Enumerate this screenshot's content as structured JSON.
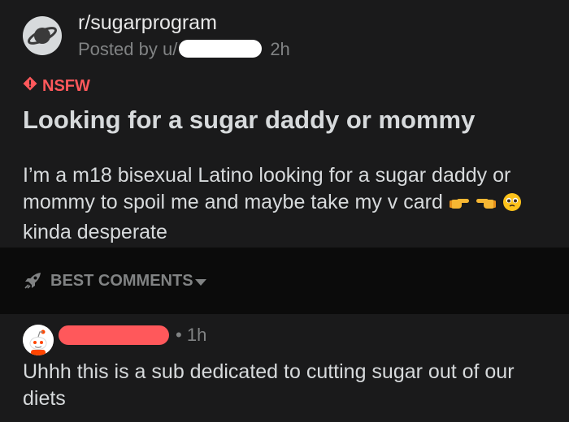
{
  "post": {
    "subreddit": "r/sugarprogram",
    "posted_by_prefix": "Posted by u/",
    "time": "2h",
    "nsfw_label": "NSFW",
    "title": "Looking for a sugar daddy or mommy",
    "body": "I’m a m18 bisexual Latino looking for a sugar daddy or mommy to spoil me and maybe take my v card",
    "body_tail": "kinda desperate",
    "emojis": [
      "backhand-index-pointing-right-icon",
      "backhand-index-pointing-left-icon",
      "pleading-face-icon"
    ]
  },
  "sort": {
    "label": "BEST COMMENTS",
    "icon": "rocket-icon"
  },
  "comment": {
    "time": "1h",
    "text": "Uhhh this is a sub dedicated to cutting sugar out of our diets"
  },
  "colors": {
    "background": "#1a1a1b",
    "sort_bar": "#0b0b0b",
    "text": "#d7dadc",
    "muted": "#818384",
    "nsfw": "#ff585b",
    "redaction_user": "#ffffff",
    "redaction_commenter": "#ff585b"
  }
}
